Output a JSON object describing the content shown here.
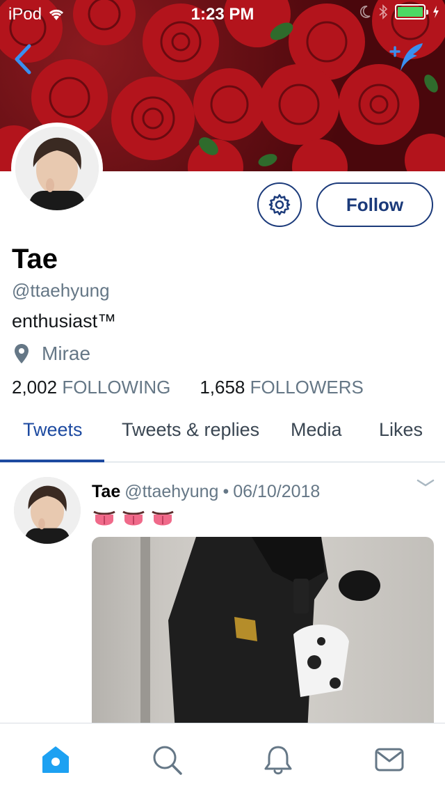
{
  "status_bar": {
    "device": "iPod",
    "time": "1:23 PM"
  },
  "profile": {
    "name": "Tae",
    "handle": "@ttaehyung",
    "bio": "enthusiast™",
    "location": "Mirae",
    "following_count": "2,002",
    "following_label": "FOLLOWING",
    "followers_count": "1,658",
    "followers_label": "FOLLOWERS",
    "follow_button": "Follow"
  },
  "tabs": [
    {
      "label": "Tweets",
      "active": true
    },
    {
      "label": "Tweets & replies",
      "active": false
    },
    {
      "label": "Media",
      "active": false
    },
    {
      "label": "Likes",
      "active": false
    }
  ],
  "tweet": {
    "author": "Tae",
    "handle": "@ttaehyung",
    "separator": "•",
    "date": "06/10/2018",
    "emojis": [
      "tongue-emoji",
      "tongue-emoji",
      "tongue-emoji"
    ]
  },
  "bottom_nav": [
    "home-icon",
    "search-icon",
    "notifications-bell-icon",
    "messages-envelope-icon"
  ],
  "colors": {
    "accent": "#1d4aa0",
    "follow_border": "#1b3a7a",
    "secondary_text": "#657786",
    "active_home": "#1da1f2"
  }
}
